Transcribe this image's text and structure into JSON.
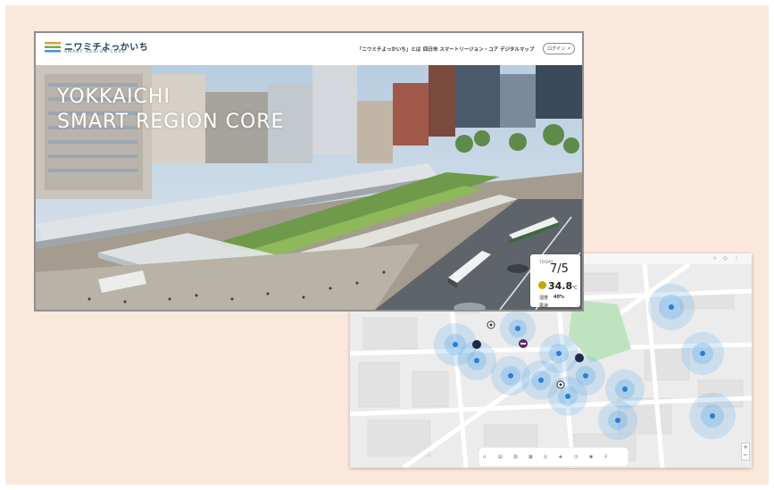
{
  "site": {
    "logo_text": "ニワミチよっかいち",
    "logo_sub": "SMART REGION CORE",
    "nav": {
      "link1": "「ニワミチよっかいち」とは",
      "link2": "四日市 スマートリージョン・コア",
      "link3": "デジタルマップ",
      "login": "ログイン"
    },
    "hero": {
      "line1": "YOKKAICHI",
      "line2": "SMART REGION CORE"
    },
    "weather": {
      "label": "TODAY",
      "date": "7/5",
      "temp": "34.8",
      "temp_unit": "℃",
      "humidity_label": "湿度",
      "humidity_value": "40%",
      "extra_label": "風速"
    }
  },
  "map": {
    "wifi_color": "#6aaee8",
    "park_color": "#bfe3bf"
  },
  "colors": {
    "background": "#fae8dc",
    "logo_stripes": [
      "#e89a3c",
      "#6ab04c",
      "#4a90d9"
    ]
  }
}
